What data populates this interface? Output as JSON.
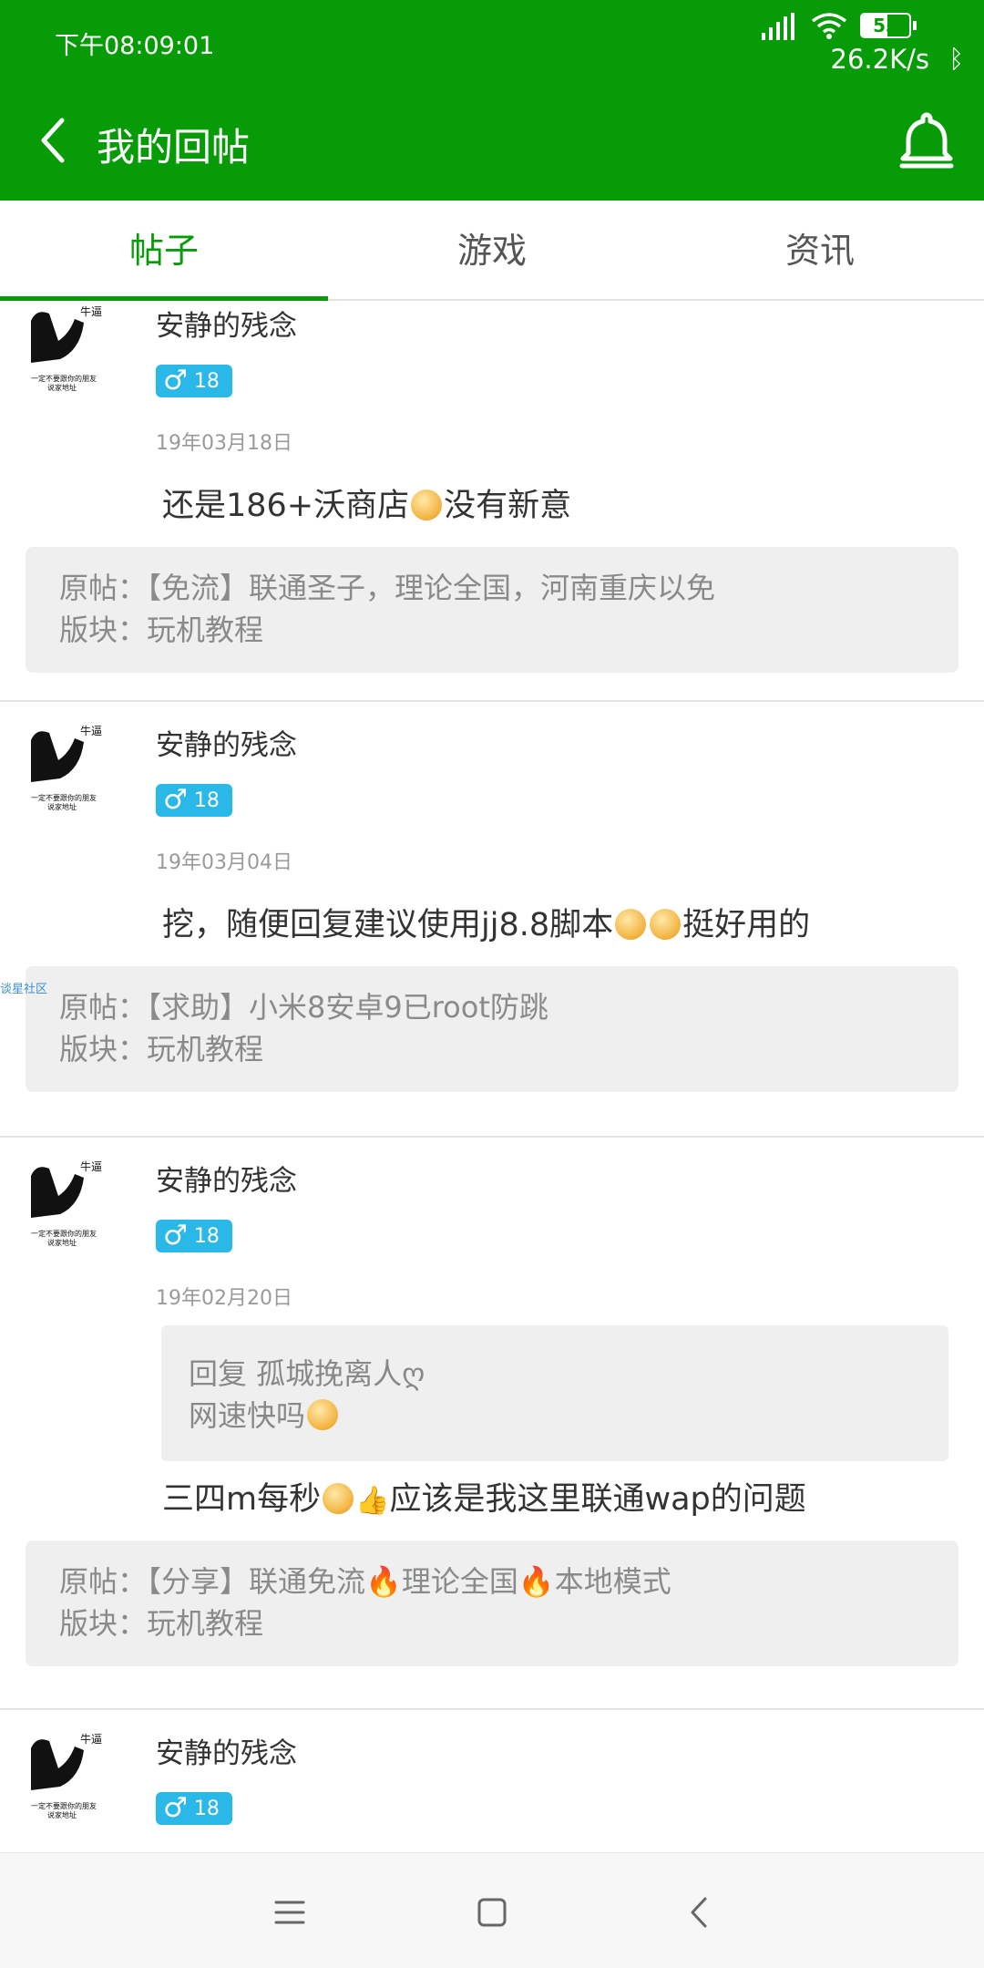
{
  "status": {
    "time": "下午08:09:01",
    "battery": "53",
    "net_speed": "26.2K/s"
  },
  "header": {
    "title": "我的回帖",
    "back_icon": "back-arrow-icon",
    "bell_icon": "bell-icon"
  },
  "colors": {
    "brand": "#079c07",
    "badge": "#29b8e8"
  },
  "tabs": [
    {
      "label": "帖子",
      "active": true
    },
    {
      "label": "游戏",
      "active": false
    },
    {
      "label": "资讯",
      "active": false
    }
  ],
  "watermark": "谈星社区",
  "posts": [
    {
      "username": "安静的残念",
      "gender_symbol": "♂",
      "level": "18",
      "date": "19年03月18日",
      "content_a": "还是186+沃商店",
      "content_b": "没有新意",
      "original_label": "原帖：【免流】联通圣子，理论全国，河南重庆以免",
      "board": "版块：玩机教程"
    },
    {
      "username": "安静的残念",
      "gender_symbol": "♂",
      "level": "18",
      "date": "19年03月04日",
      "content_a": "挖，随便回复建议使用jj8.8脚本",
      "content_b": "挺好用的",
      "original_label": "原帖：【求助】小米8安卓9已root防跳",
      "board": "版块：玩机教程"
    },
    {
      "username": "安静的残念",
      "gender_symbol": "♂",
      "level": "18",
      "date": "19年02月20日",
      "reply_to": "回复 孤城挽离人ღ",
      "reply_text": "网速快吗",
      "content_a": "三四m每秒",
      "content_b": "应该是我这里联通wap的问题",
      "original_a": "原帖：【分享】联通免流",
      "original_b": "理论全国",
      "original_c": "本地模式",
      "board": "版块：玩机教程"
    },
    {
      "username": "安静的残念",
      "gender_symbol": "♂",
      "level": "18"
    }
  ],
  "navbar": {
    "menu_icon": "menu-icon",
    "home_icon": "home-square-icon",
    "back_icon": "back-triangle-icon"
  }
}
